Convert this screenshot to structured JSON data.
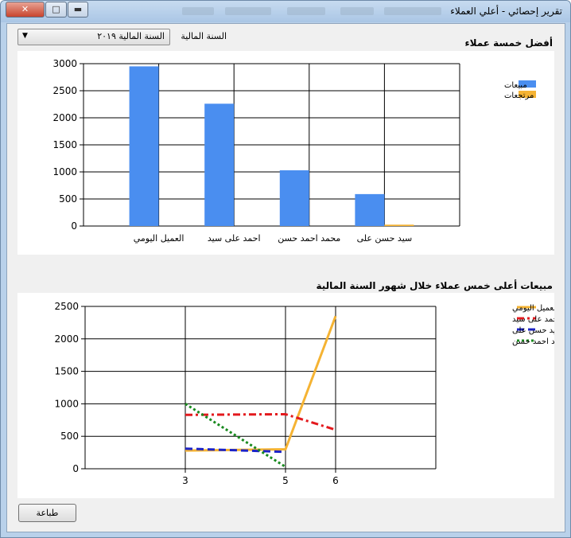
{
  "window": {
    "title": "تقرير إحصائي - أعلي العملاء",
    "minimize_label": "▬",
    "maximize_label": "□",
    "close_label": "✕"
  },
  "filter": {
    "label": "السنة المالية",
    "selected": "السنة المالية ٢٠١٩"
  },
  "chart1_heading": "أفضل خمسة عملاء",
  "chart2_heading": "مبيعات أعلى خمس عملاء خلال شهور السنة المالية",
  "print_button": "طباعة",
  "colors": {
    "blue": "#4a8ef0",
    "orange": "#f5b333",
    "red": "#e3191d",
    "navy": "#1c23c7",
    "green": "#198a1f"
  },
  "chart_data": [
    {
      "type": "bar",
      "categories": [
        "العميل اليومي",
        "احمد على سيد",
        "محمد احمد حسن",
        "سيد حسن على"
      ],
      "series": [
        {
          "name": "مبيعات",
          "values": [
            2950,
            2260,
            1030,
            590
          ],
          "color": "#4a8ef0"
        },
        {
          "name": "مرتجعات",
          "values": [
            0,
            0,
            0,
            25
          ],
          "color": "#f5b333"
        }
      ],
      "ylim": [
        0,
        3000
      ],
      "yticks": [
        0,
        500,
        1000,
        1500,
        2000,
        2500,
        3000
      ],
      "grid": true,
      "legend": "top-right"
    },
    {
      "type": "line",
      "x": [
        3,
        5,
        6
      ],
      "series": [
        {
          "name": "العميل اليومي",
          "values": [
            280,
            300,
            2350
          ],
          "color": "#f5b333",
          "dash": "solid"
        },
        {
          "name": "احمد على سيد",
          "values": [
            830,
            840,
            600
          ],
          "color": "#e3191d",
          "dash": "dashdot"
        },
        {
          "name": "سيد حسن على",
          "values": [
            310,
            260,
            null
          ],
          "color": "#1c23c7",
          "dash": "dash"
        },
        {
          "name": "محمد احمد حسن",
          "values": [
            1000,
            30,
            null
          ],
          "color": "#198a1f",
          "dash": "dot"
        }
      ],
      "ylim": [
        0,
        2500
      ],
      "yticks": [
        0,
        500,
        1000,
        1500,
        2000,
        2500
      ],
      "grid": true,
      "legend": "top-right"
    }
  ]
}
